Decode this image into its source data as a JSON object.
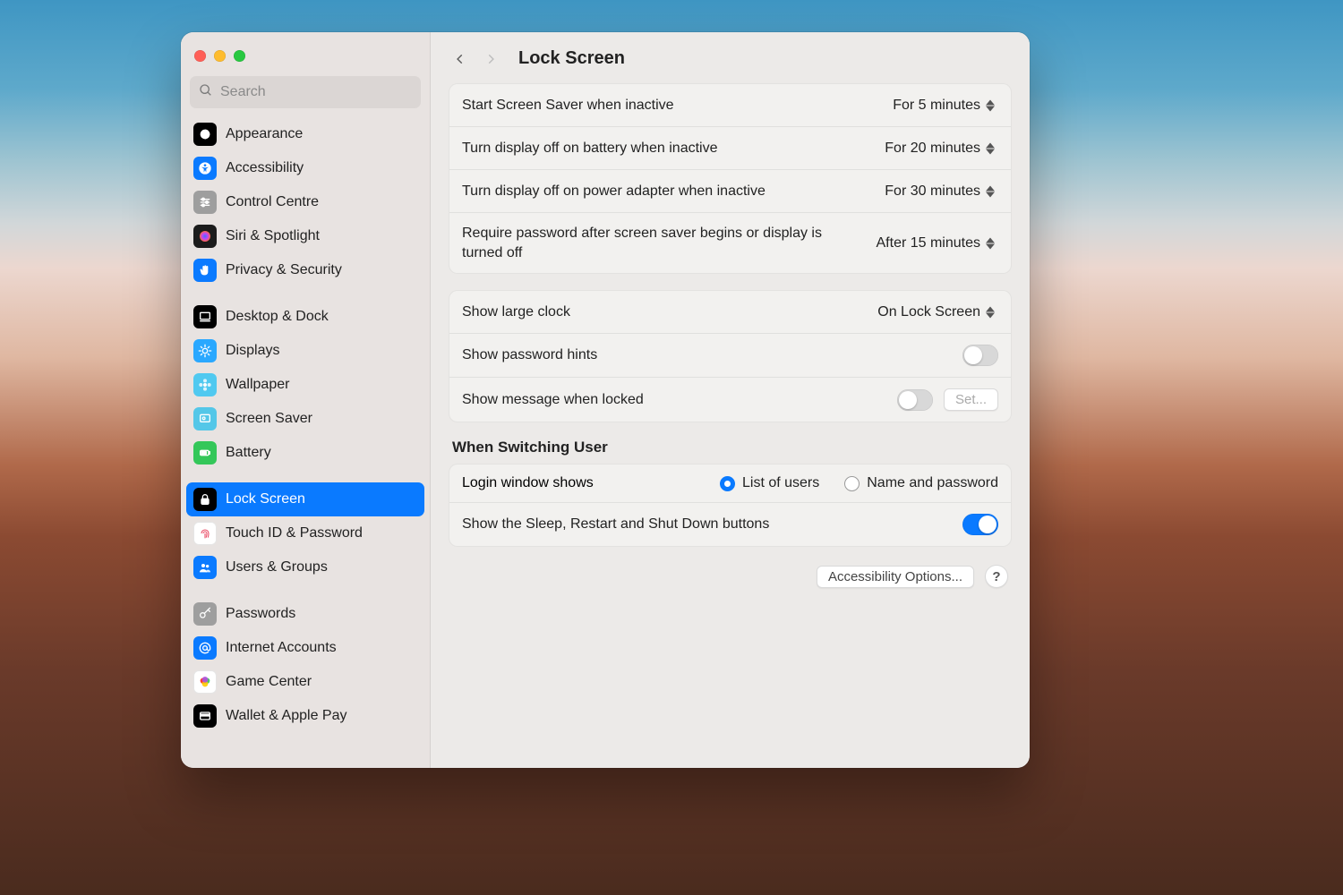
{
  "window": {
    "title": "Lock Screen"
  },
  "search": {
    "placeholder": "Search"
  },
  "sidebar": {
    "groups": [
      {
        "items": [
          {
            "id": "appearance",
            "label": "Appearance",
            "icon": "appearance-icon",
            "bg": "#000000"
          },
          {
            "id": "accessibility",
            "label": "Accessibility",
            "icon": "accessibility-icon",
            "bg": "#0a7aff"
          },
          {
            "id": "control-centre",
            "label": "Control Centre",
            "icon": "sliders-icon",
            "bg": "#9e9e9e"
          },
          {
            "id": "siri-spotlight",
            "label": "Siri & Spotlight",
            "icon": "siri-icon",
            "bg": "#1b1b1b"
          },
          {
            "id": "privacy-security",
            "label": "Privacy & Security",
            "icon": "hand-icon",
            "bg": "#0a7aff"
          }
        ]
      },
      {
        "items": [
          {
            "id": "desktop-dock",
            "label": "Desktop & Dock",
            "icon": "desktop-icon",
            "bg": "#000000"
          },
          {
            "id": "displays",
            "label": "Displays",
            "icon": "sun-icon",
            "bg": "#2aa8ff"
          },
          {
            "id": "wallpaper",
            "label": "Wallpaper",
            "icon": "flower-icon",
            "bg": "#50c9f0"
          },
          {
            "id": "screen-saver",
            "label": "Screen Saver",
            "icon": "screensaver-icon",
            "bg": "#54c7e8"
          },
          {
            "id": "battery",
            "label": "Battery",
            "icon": "battery-icon",
            "bg": "#34c759"
          }
        ]
      },
      {
        "items": [
          {
            "id": "lock-screen",
            "label": "Lock Screen",
            "icon": "lock-icon",
            "bg": "#000000",
            "selected": true
          },
          {
            "id": "touch-id",
            "label": "Touch ID & Password",
            "icon": "fingerprint-icon",
            "bg": "#ffffff"
          },
          {
            "id": "users-groups",
            "label": "Users & Groups",
            "icon": "users-icon",
            "bg": "#0a7aff"
          }
        ]
      },
      {
        "items": [
          {
            "id": "passwords",
            "label": "Passwords",
            "icon": "key-icon",
            "bg": "#9e9e9e"
          },
          {
            "id": "internet-accounts",
            "label": "Internet Accounts",
            "icon": "at-icon",
            "bg": "#0a7aff"
          },
          {
            "id": "game-center",
            "label": "Game Center",
            "icon": "gamecenter-icon",
            "bg": "#ffffff"
          },
          {
            "id": "wallet-apple-pay",
            "label": "Wallet & Apple Pay",
            "icon": "wallet-icon",
            "bg": "#000000"
          }
        ]
      }
    ]
  },
  "settings": {
    "group1": {
      "screen_saver": {
        "label": "Start Screen Saver when inactive",
        "value": "For 5 minutes"
      },
      "display_battery": {
        "label": "Turn display off on battery when inactive",
        "value": "For 20 minutes"
      },
      "display_power": {
        "label": "Turn display off on power adapter when inactive",
        "value": "For 30 minutes"
      },
      "require_password": {
        "label": "Require password after screen saver begins or display is turned off",
        "value": "After 15 minutes"
      }
    },
    "group2": {
      "large_clock": {
        "label": "Show large clock",
        "value": "On Lock Screen"
      },
      "password_hints": {
        "label": "Show password hints",
        "on": false
      },
      "show_message": {
        "label": "Show message when locked",
        "on": false,
        "button": "Set..."
      }
    },
    "switching_user": {
      "title": "When Switching User",
      "login_window": {
        "label": "Login window shows",
        "options": {
          "list": "List of users",
          "namepw": "Name and password"
        },
        "selected": "list"
      },
      "sleep_buttons": {
        "label": "Show the Sleep, Restart and Shut Down buttons",
        "on": true
      }
    },
    "footer": {
      "accessibility": "Accessibility Options..."
    }
  }
}
